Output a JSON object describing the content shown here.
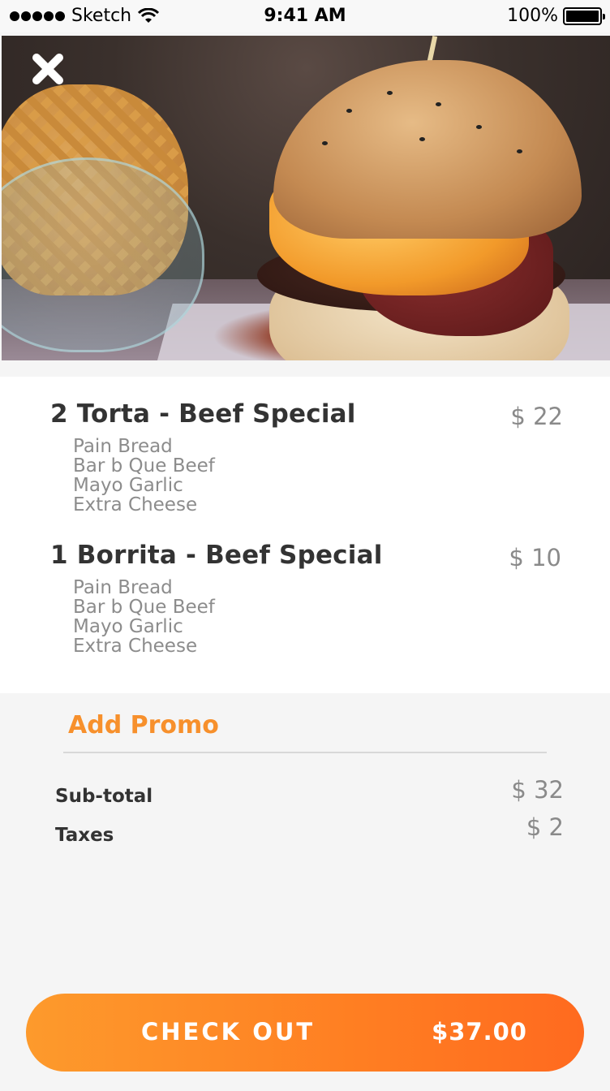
{
  "status_bar": {
    "carrier": "Sketch",
    "time": "9:41 AM",
    "battery": "100%"
  },
  "hero": {
    "close_icon": "close-icon"
  },
  "items": [
    {
      "title": "2 Torta - Beef Special",
      "price": "$ 22",
      "modifiers": [
        "Pain Bread",
        "Bar b Que Beef",
        "Mayo Garlic",
        "Extra Cheese"
      ]
    },
    {
      "title": "1 Borrita - Beef Special",
      "price": "$ 10",
      "modifiers": [
        "Pain Bread",
        "Bar b Que Beef",
        "Mayo Garlic",
        "Extra Cheese"
      ]
    }
  ],
  "promo": {
    "label": "Add Promo"
  },
  "totals": {
    "subtotal_label": "Sub-total",
    "subtotal_value": "$ 32",
    "taxes_label": "Taxes",
    "taxes_value": "$ 2"
  },
  "checkout": {
    "label": "CHECK OUT",
    "total": "$37.00"
  },
  "colors": {
    "accent": "#f7902c",
    "button_start": "#fd9a2c",
    "button_end": "#ff6a1f"
  }
}
